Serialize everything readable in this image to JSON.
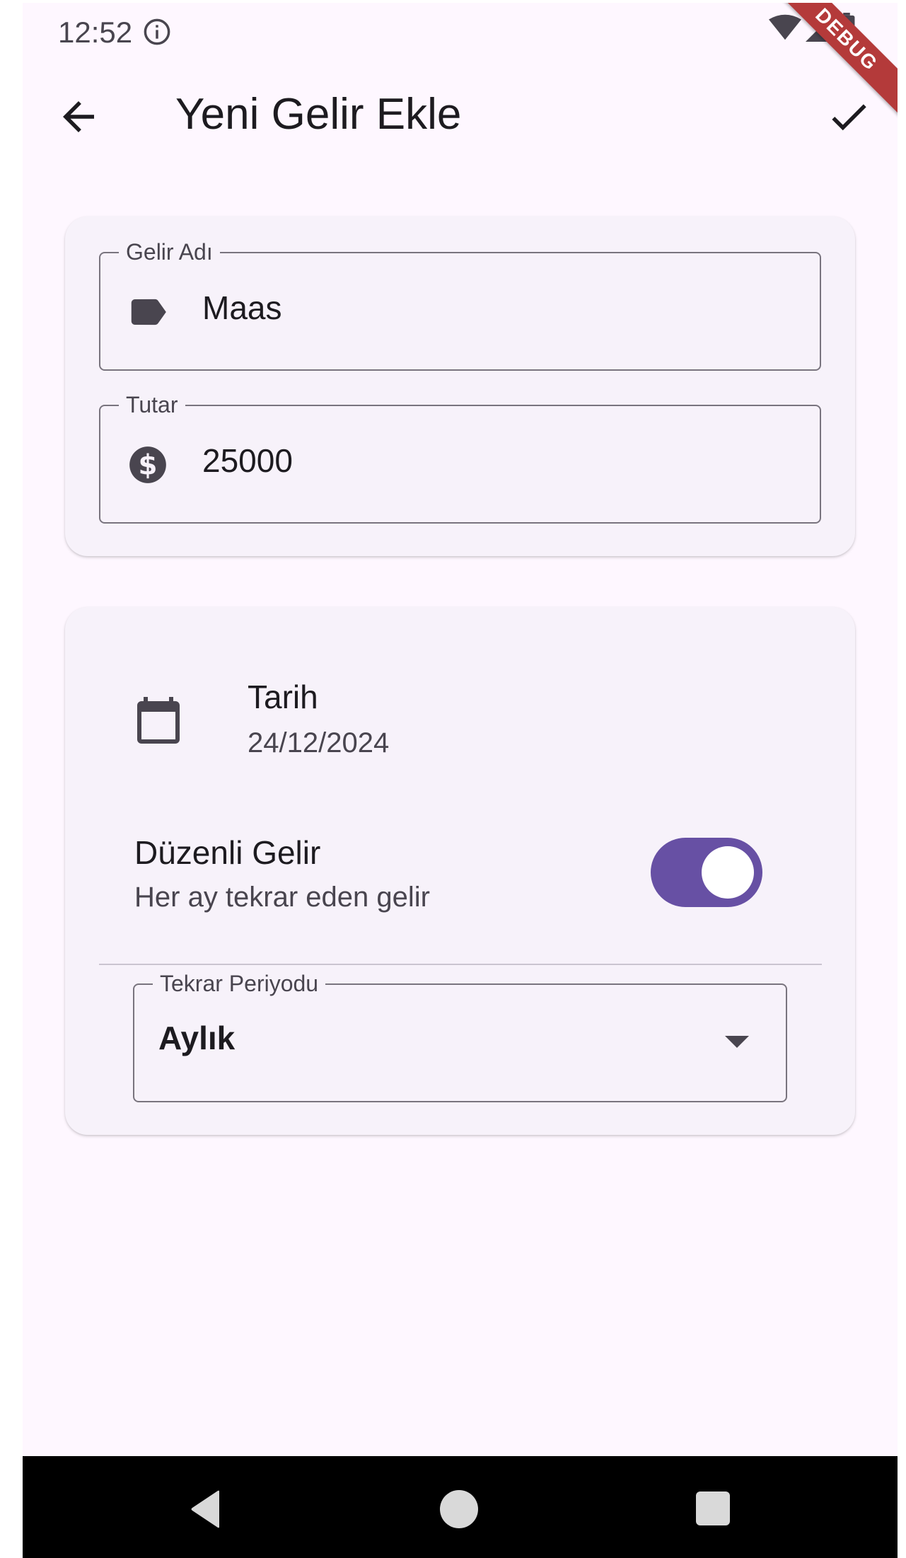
{
  "status_bar": {
    "time": "12:52",
    "debug_label": "DEBUG"
  },
  "app_bar": {
    "title": "Yeni Gelir Ekle"
  },
  "income_form": {
    "name_field": {
      "label": "Gelir Adı",
      "value": "Maas",
      "icon": "label-tag-icon"
    },
    "amount_field": {
      "label": "Tutar",
      "value": "25000",
      "icon": "dollar-icon"
    }
  },
  "details": {
    "date": {
      "title": "Tarih",
      "value": "24/12/2024",
      "icon": "calendar-icon"
    },
    "recurring": {
      "title": "Düzenli Gelir",
      "subtitle": "Her ay tekrar eden gelir",
      "enabled": true
    },
    "period": {
      "label": "Tekrar Periyodu",
      "selected": "Aylık"
    }
  },
  "colors": {
    "accent": "#6750a4",
    "background": "#fef7ff",
    "card": "#f7f2fa",
    "debug": "#b43a3a"
  }
}
